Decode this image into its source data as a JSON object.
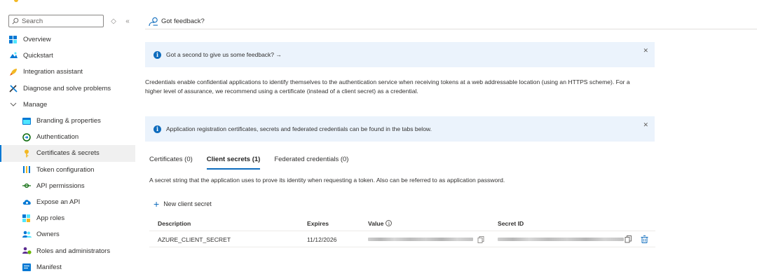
{
  "sidebar": {
    "search_placeholder": "Search",
    "items": [
      {
        "label": "Overview",
        "icon": "overview-icon",
        "level": 0
      },
      {
        "label": "Quickstart",
        "icon": "quickstart-icon",
        "level": 0
      },
      {
        "label": "Integration assistant",
        "icon": "rocket-icon",
        "level": 0
      },
      {
        "label": "Diagnose and solve problems",
        "icon": "wrench-icon",
        "level": 0
      },
      {
        "label": "Manage",
        "icon": "chevron-down-icon",
        "level": 0
      },
      {
        "label": "Branding & properties",
        "icon": "branding-icon",
        "level": 1
      },
      {
        "label": "Authentication",
        "icon": "authentication-icon",
        "level": 1
      },
      {
        "label": "Certificates & secrets",
        "icon": "key-icon",
        "level": 1,
        "selected": true
      },
      {
        "label": "Token configuration",
        "icon": "token-icon",
        "level": 1
      },
      {
        "label": "API permissions",
        "icon": "api-permissions-icon",
        "level": 1
      },
      {
        "label": "Expose an API",
        "icon": "cloud-icon",
        "level": 1
      },
      {
        "label": "App roles",
        "icon": "app-roles-icon",
        "level": 1
      },
      {
        "label": "Owners",
        "icon": "owners-icon",
        "level": 1
      },
      {
        "label": "Roles and administrators",
        "icon": "roles-icon",
        "level": 1
      },
      {
        "label": "Manifest",
        "icon": "manifest-icon",
        "level": 1
      }
    ]
  },
  "cmdbar": {
    "feedback_label": "Got feedback?"
  },
  "banner1": {
    "text": "Got a second to give us some feedback? →"
  },
  "description": "Credentials enable confidential applications to identify themselves to the authentication service when receiving tokens at a web addressable location (using an HTTPS scheme). For a higher level of assurance, we recommend using a certificate (instead of a client secret) as a credential.",
  "banner2": {
    "text": "Application registration certificates, secrets and federated credentials can be found in the tabs below."
  },
  "tabs": [
    {
      "label": "Certificates (0)",
      "active": false
    },
    {
      "label": "Client secrets (1)",
      "active": true
    },
    {
      "label": "Federated credentials (0)",
      "active": false
    }
  ],
  "tab_description": "A secret string that the application uses to prove its identity when requesting a token. Also can be referred to as application password.",
  "new_secret_label": "New client secret",
  "table": {
    "headers": {
      "description": "Description",
      "expires": "Expires",
      "value": "Value",
      "secret_id": "Secret ID"
    },
    "rows": [
      {
        "description": "AZURE_CLIENT_SECRET",
        "expires": "11/12/2026"
      }
    ]
  },
  "colors": {
    "accent": "#0f6cbd",
    "selected_bg": "#f0f0f0",
    "banner_bg": "#ebf3fc"
  }
}
